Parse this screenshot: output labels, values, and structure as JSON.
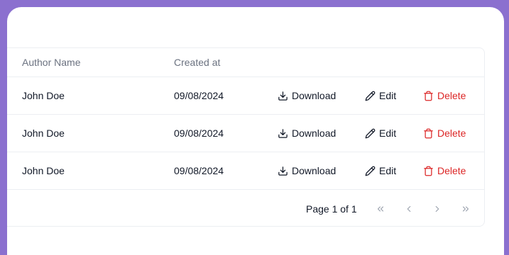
{
  "table": {
    "headers": {
      "author": "Author Name",
      "created": "Created at"
    },
    "rows": [
      {
        "author": "John Doe",
        "created": "09/08/2024"
      },
      {
        "author": "John Doe",
        "created": "09/08/2024"
      },
      {
        "author": "John Doe",
        "created": "09/08/2024"
      }
    ],
    "actions": {
      "download_label": "Download",
      "edit_label": "Edit",
      "delete_label": "Delete"
    }
  },
  "pagination": {
    "page_text": "Page 1 of 1",
    "icons": [
      "chevrons-left-icon",
      "chevron-left-icon",
      "chevron-right-icon",
      "chevrons-right-icon"
    ]
  },
  "colors": {
    "background": "#8b70cf",
    "delete": "#dc2626",
    "muted": "#6b7280",
    "text": "#111827"
  }
}
